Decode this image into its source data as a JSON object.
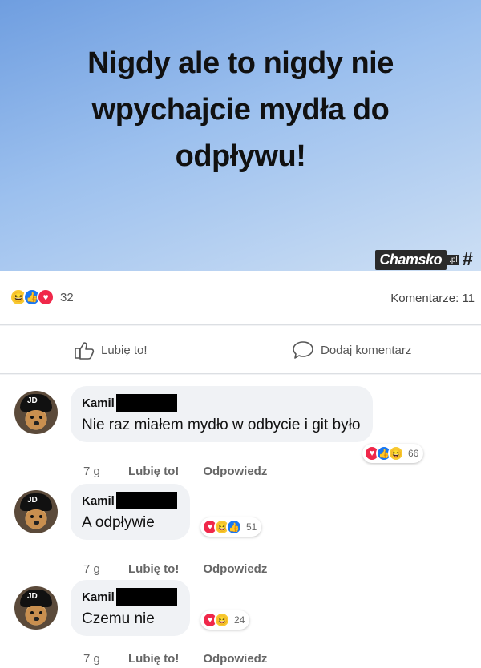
{
  "post": {
    "title": "Nigdy ale to nigdy nie wpychajcie mydła do odpływu!",
    "watermark": "Chamsko",
    "watermark_suffix": ".pl",
    "reactions_count": "32",
    "comments_count": "Komentarze: 11"
  },
  "actions": {
    "like": "Lubię to!",
    "comment": "Dodaj komentarz"
  },
  "comments": [
    {
      "author": "Kamil",
      "text": "Nie raz miałem mydło w odbycie i git było",
      "time": "7 g",
      "like": "Lubię to!",
      "reply": "Odpowiedz",
      "reactions": "66"
    },
    {
      "author": "Kamil",
      "text": "A odpływie",
      "time": "7 g",
      "like": "Lubię to!",
      "reply": "Odpowiedz",
      "reactions": "51"
    },
    {
      "author": "Kamil",
      "text": "Czemu nie",
      "time": "7 g",
      "like": "Lubię to!",
      "reply": "Odpowiedz",
      "reactions": "24"
    }
  ]
}
